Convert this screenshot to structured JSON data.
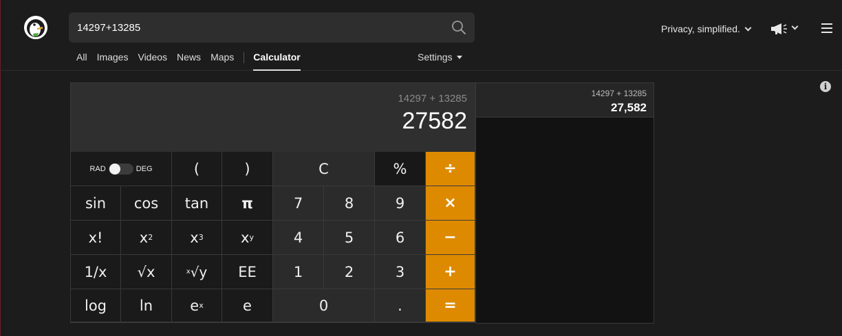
{
  "search": {
    "value": "14297+13285"
  },
  "nav": {
    "all": "All",
    "images": "Images",
    "videos": "Videos",
    "news": "News",
    "maps": "Maps",
    "calculator": "Calculator",
    "settings": "Settings"
  },
  "header": {
    "privacy": "Privacy, simplified."
  },
  "calculator": {
    "expression": "14297 + 13285",
    "result": "27582",
    "toggle": {
      "rad": "RAD",
      "deg": "DEG"
    },
    "keys": {
      "lparen": "(",
      "rparen": ")",
      "clear": "C",
      "percent": "%",
      "divide": "÷",
      "sin": "sin",
      "cos": "cos",
      "tan": "tan",
      "pi": "π",
      "seven": "7",
      "eight": "8",
      "nine": "9",
      "multiply": "×",
      "fact": "x!",
      "sq_base": "x",
      "sq_exp": "2",
      "cube_base": "x",
      "cube_exp": "3",
      "pow_base": "x",
      "pow_exp": "y",
      "four": "4",
      "five": "5",
      "six": "6",
      "minus": "−",
      "reciprocal": "1/x",
      "sqrt": "√x",
      "xroot_pre": "x",
      "xroot_main": "√y",
      "ee": "EE",
      "one": "1",
      "two": "2",
      "three": "3",
      "plus": "+",
      "log": "log",
      "ln": "ln",
      "exp_base": "e",
      "exp_exp": "x",
      "e": "e",
      "zero": "0",
      "dot": ".",
      "equals": "="
    }
  },
  "history": {
    "entries": [
      {
        "expression": "14297 + 13285",
        "result": "27,582"
      }
    ]
  },
  "colors": {
    "accent": "#de8a00",
    "background": "#1c1c1c"
  },
  "icons": {
    "search": "search-icon",
    "megaphone": "megaphone-icon",
    "menu": "hamburger-menu-icon",
    "info": "info-icon",
    "logo": "duckduckgo-logo"
  }
}
